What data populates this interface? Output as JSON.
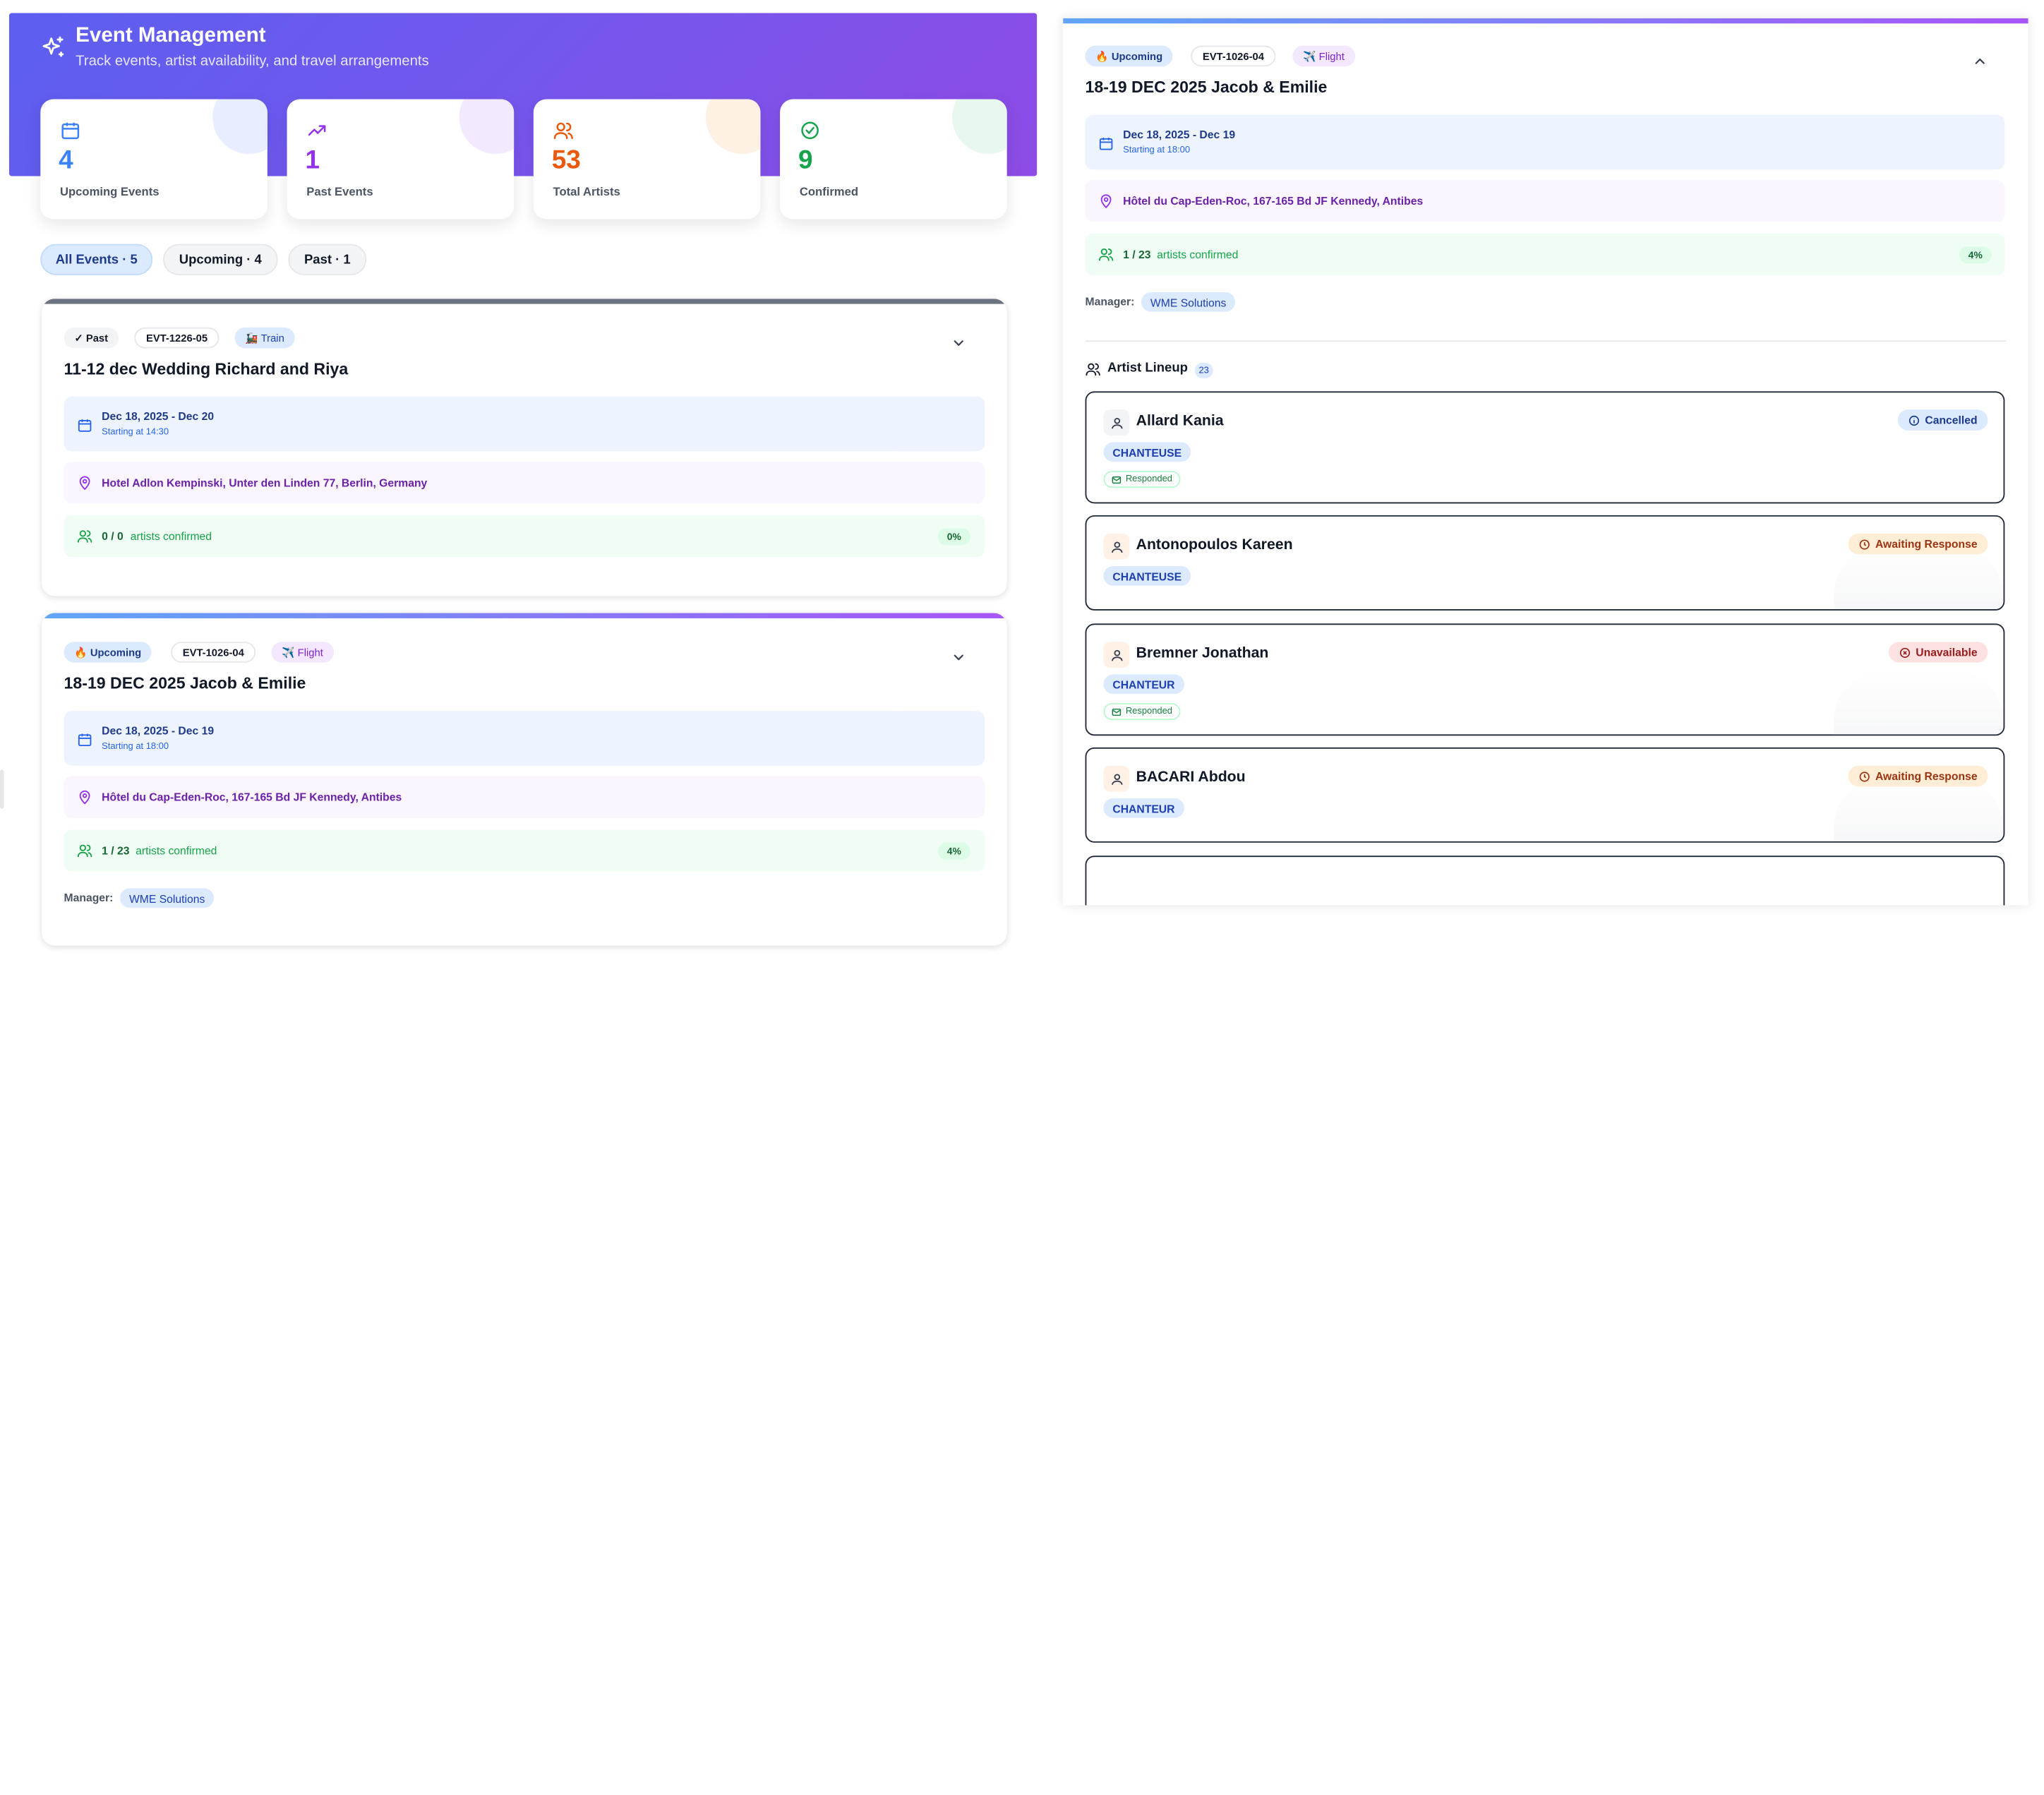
{
  "header": {
    "title": "Event Management",
    "subtitle": "Track events, artist availability, and travel arrangements"
  },
  "stats": [
    {
      "value": "4",
      "label": "Upcoming Events",
      "icon": "calendar-icon",
      "color": "#3b82f6"
    },
    {
      "value": "1",
      "label": "Past Events",
      "icon": "trending-up-icon",
      "color": "#9333ea"
    },
    {
      "value": "53",
      "label": "Total Artists",
      "icon": "users-icon",
      "color": "#ea580c"
    },
    {
      "value": "9",
      "label": "Confirmed",
      "icon": "check-circle-icon",
      "color": "#16a34a"
    }
  ],
  "filters": [
    {
      "label": "All Events · 5",
      "active": true
    },
    {
      "label": "Upcoming · 4",
      "active": false
    },
    {
      "label": "Past · 1",
      "active": false
    }
  ],
  "events": [
    {
      "status": "✓ Past",
      "code": "EVT-1226-05",
      "transport": "🚂 Train",
      "title": "11-12 dec Wedding Richard and Riya",
      "date_range": "Dec 18, 2025 - Dec 20",
      "start": "Starting at 14:30",
      "location": "Hotel Adlon Kempinski, Unter den Linden 77, Berlin, Germany",
      "artists_count": "0 / 0",
      "artists_label": "artists confirmed",
      "percent": "0%"
    },
    {
      "status": "🔥 Upcoming",
      "code": "EVT-1026-04",
      "transport": "✈️ Flight",
      "title": "18-19 DEC 2025 Jacob & Emilie",
      "date_range": "Dec 18, 2025 - Dec 19",
      "start": "Starting at 18:00",
      "location": "Hôtel du Cap-Eden-Roc, 167-165 Bd JF Kennedy, Antibes",
      "artists_count": "1 / 23",
      "artists_label": "artists confirmed",
      "percent": "4%",
      "manager_label": "Manager:",
      "manager": "WME Solutions"
    }
  ],
  "detail": {
    "status": "🔥 Upcoming",
    "code": "EVT-1026-04",
    "transport": "✈️ Flight",
    "title": "18-19 DEC 2025 Jacob & Emilie",
    "date_range": "Dec 18, 2025 - Dec 19",
    "start": "Starting at 18:00",
    "location": "Hôtel du Cap-Eden-Roc, 167-165 Bd JF Kennedy, Antibes",
    "artists_count": "1 / 23",
    "artists_label": "artists confirmed",
    "percent": "4%",
    "manager_label": "Manager:",
    "manager": "WME Solutions",
    "lineup_title": "Artist Lineup",
    "lineup_count": "23",
    "artists": [
      {
        "name": "Allard Kania",
        "role": "CHANTEUSE",
        "status": "Cancelled",
        "responded": "Responded"
      },
      {
        "name": "Antonopoulos Kareen",
        "role": "CHANTEUSE",
        "status": "Awaiting Response"
      },
      {
        "name": "Bremner Jonathan",
        "role": "CHANTEUR",
        "status": "Unavailable",
        "responded": "Responded"
      },
      {
        "name": "BACARI Abdou",
        "role": "CHANTEUR",
        "status": "Awaiting Response"
      }
    ]
  },
  "colors": {
    "hero_start": "#5b5ff0",
    "hero_end": "#8e4be6",
    "accent_blue": "#1e40af",
    "success": "#16a34a",
    "warning": "#9a3412",
    "danger": "#991b1b"
  }
}
